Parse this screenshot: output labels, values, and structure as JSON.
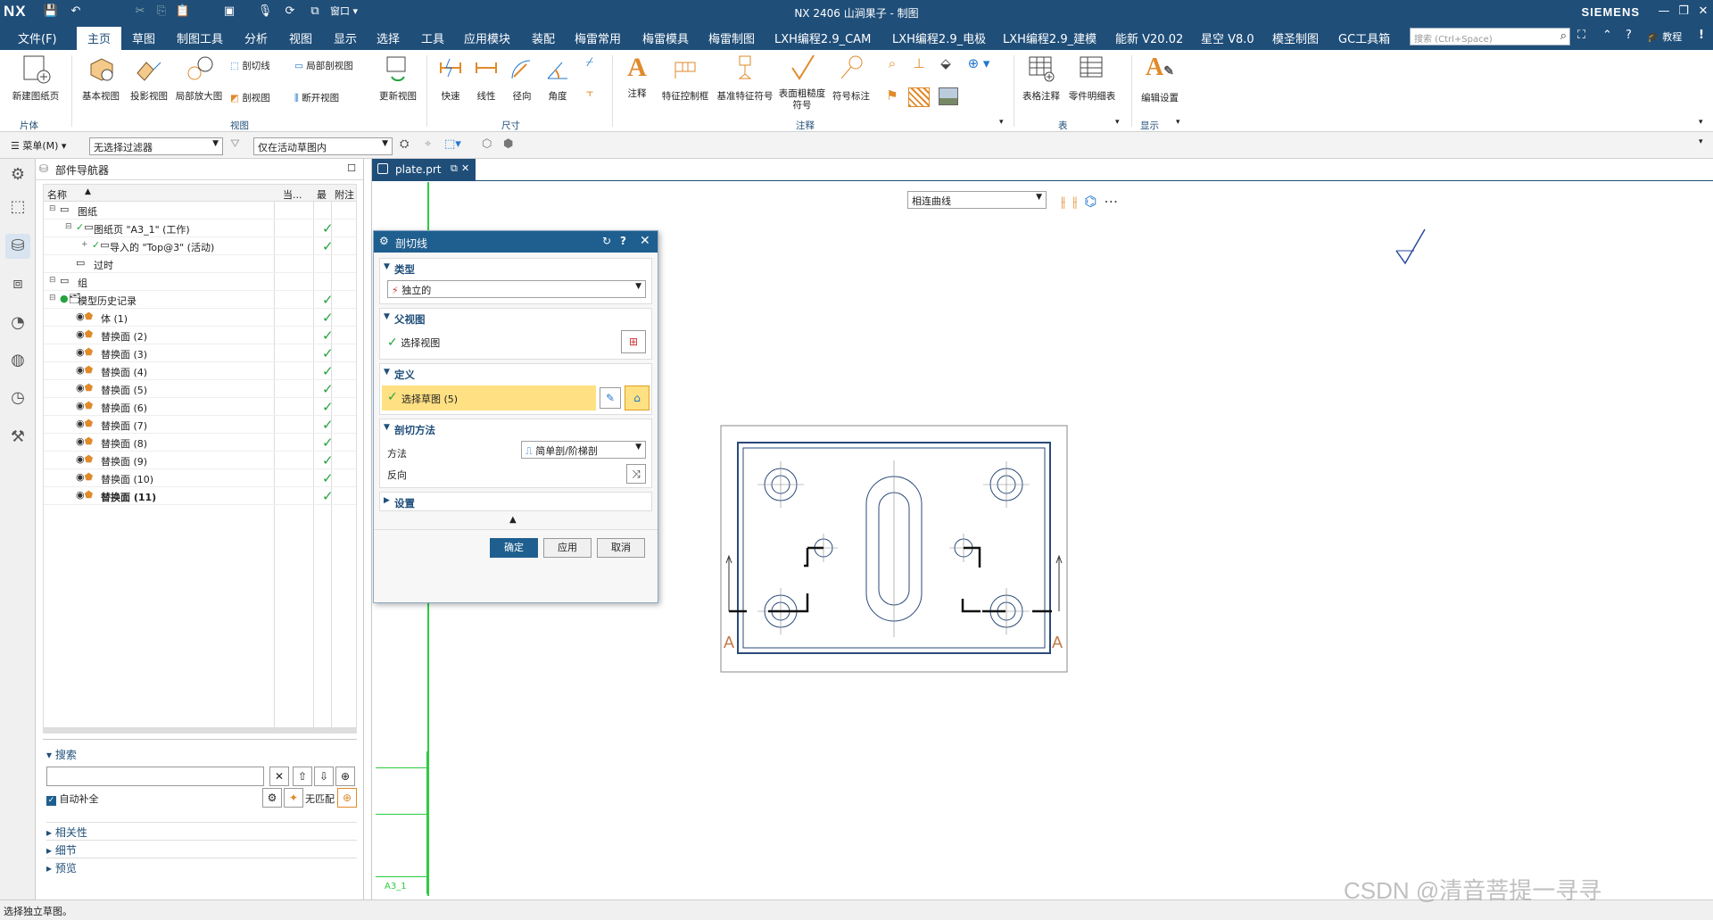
{
  "app": {
    "logo": "NX",
    "title": "NX 2406 山涧果子 - 制图",
    "brand": "SIEMENS",
    "window_menu": "窗口"
  },
  "menu": {
    "items": [
      "文件(F)",
      "主页",
      "草图",
      "制图工具",
      "分析",
      "视图",
      "显示",
      "选择",
      "工具",
      "应用模块",
      "装配",
      "梅雷常用",
      "梅雷模具",
      "梅雷制图",
      "LXH编程2.9_CAM",
      "LXH编程2.9_电极",
      "LXH编程2.9_建模",
      "能新 V20.02",
      "星空 V8.0",
      "模圣制图",
      "GC工具箱"
    ],
    "search_placeholder": "搜索 (Ctrl+Space)",
    "tutorial": "教程"
  },
  "ribbon": {
    "sheet_group": {
      "new_sheet": "新建图纸页",
      "label": "片体"
    },
    "view_group": {
      "base_view": "基本视图",
      "projected_view": "投影视图",
      "detail_view": "局部放大图",
      "section_line": "剖切线",
      "section_view": "剖视图",
      "break_section": "局部剖视图",
      "break_view": "断开视图",
      "update_view": "更新视图",
      "label": "视图"
    },
    "dim_group": {
      "rapid": "快速",
      "linear": "线性",
      "radial": "径向",
      "angle": "角度",
      "label": "尺寸"
    },
    "note_group": {
      "note": "注释",
      "fcf": "特征控制框",
      "datum": "基准特征符号",
      "surface_finish": "表面粗糙度符号",
      "id_symbol": "符号标注",
      "label": "注释"
    },
    "table_group": {
      "tabular_note": "表格注释",
      "parts_list": "零件明细表",
      "label": "表"
    },
    "display_group": {
      "edit_settings": "编辑设置",
      "label": "显示"
    }
  },
  "filterbar": {
    "menu": "菜单(M)",
    "filter": "无选择过滤器",
    "scope": "仅在活动草图内"
  },
  "navigator": {
    "title": "部件导航器",
    "columns": [
      "名称",
      "当...",
      "最",
      "附注"
    ],
    "rows": [
      {
        "label": "图纸",
        "indent": 0,
        "check": false
      },
      {
        "label": "图纸页 \"A3_1\" (工作)",
        "indent": 1,
        "check": true
      },
      {
        "label": "导入的 \"Top@3\" (活动)",
        "indent": 2,
        "check": true
      },
      {
        "label": "过时",
        "indent": 1,
        "check": false
      },
      {
        "label": "组",
        "indent": 0,
        "check": false
      },
      {
        "label": "模型历史记录",
        "indent": 0,
        "check": true
      },
      {
        "label": "体 (1)",
        "indent": 1,
        "check": true
      },
      {
        "label": "替换面 (2)",
        "indent": 1,
        "check": true
      },
      {
        "label": "替换面 (3)",
        "indent": 1,
        "check": true
      },
      {
        "label": "替换面 (4)",
        "indent": 1,
        "check": true
      },
      {
        "label": "替换面 (5)",
        "indent": 1,
        "check": true
      },
      {
        "label": "替换面 (6)",
        "indent": 1,
        "check": true
      },
      {
        "label": "替换面 (7)",
        "indent": 1,
        "check": true
      },
      {
        "label": "替换面 (8)",
        "indent": 1,
        "check": true
      },
      {
        "label": "替换面 (9)",
        "indent": 1,
        "check": true
      },
      {
        "label": "替换面 (10)",
        "indent": 1,
        "check": true
      },
      {
        "label": "替换面 (11)",
        "indent": 1,
        "check": true
      }
    ],
    "search": {
      "label": "搜索",
      "auto_complete": "自动补全",
      "no_match": "无匹配"
    },
    "sections": [
      "相关性",
      "细节",
      "预览"
    ]
  },
  "tab": {
    "label": "plate.prt"
  },
  "selbar": {
    "curve_rule": "相连曲线"
  },
  "dialog": {
    "title": "剖切线",
    "type_section": "类型",
    "type_value": "独立的",
    "parent_section": "父视图",
    "select_view": "选择视图",
    "define_section": "定义",
    "select_sketch": "选择草图 (5)",
    "method_section": "剖切方法",
    "method_label": "方法",
    "method_value": "简单剖/阶梯剖",
    "reverse_label": "反向",
    "settings": "设置",
    "ok": "确定",
    "apply": "应用",
    "cancel": "取消"
  },
  "drawing": {
    "section_letter_left": "A",
    "section_letter_right": "A",
    "sheet_label": "A3_1"
  },
  "status": "选择独立草图。",
  "watermark": "CSDN @清音菩提一寻寻",
  "colors": {
    "title_bg": "#1f4e79",
    "accent": "#1f5f8f",
    "check": "#22a33c",
    "highlight": "#ffe082",
    "drawing_line": "#2a4a7a"
  }
}
